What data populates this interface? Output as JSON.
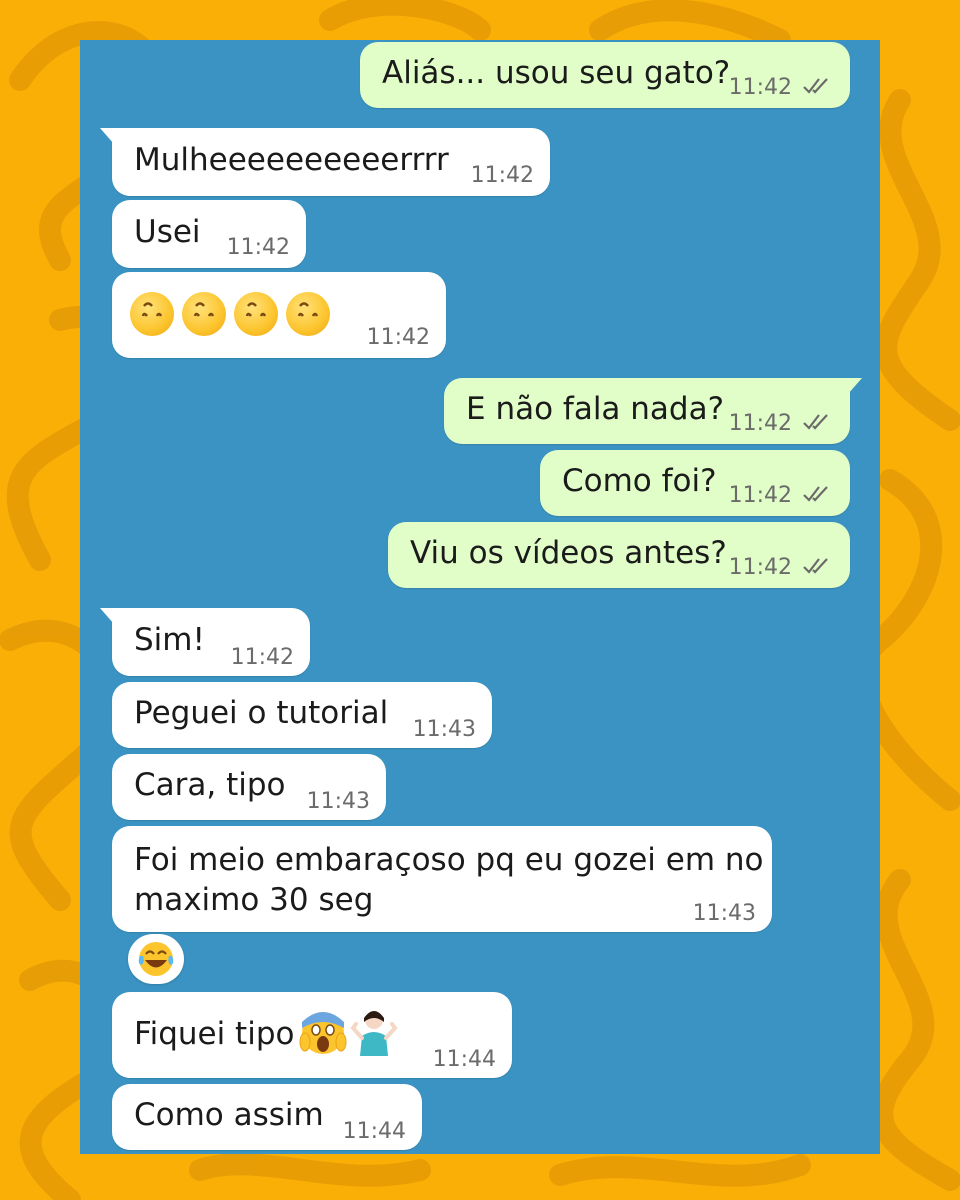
{
  "colors": {
    "background": "#F9AF06",
    "chat_background": "#3A93C2",
    "incoming_bubble": "#FFFFFF",
    "outgoing_bubble": "#E1FEC9",
    "read_ticks": "#6b6b6b"
  },
  "messages": [
    {
      "dir": "out",
      "text": "Aliás... usou seu gato?",
      "time": "11:42",
      "ticks": "double-check-icon"
    },
    {
      "dir": "in",
      "text": "Mulheeeeeeeeeerrrr",
      "time": "11:42"
    },
    {
      "dir": "in",
      "text": "Usei",
      "time": "11:42"
    },
    {
      "dir": "in",
      "text": "",
      "emoji": [
        "upside-down-face-emoji",
        "upside-down-face-emoji",
        "upside-down-face-emoji",
        "upside-down-face-emoji"
      ],
      "time": "11:42"
    },
    {
      "dir": "out",
      "text": "E não fala nada?",
      "time": "11:42",
      "ticks": "double-check-icon"
    },
    {
      "dir": "out",
      "text": "Como foi?",
      "time": "11:42",
      "ticks": "double-check-icon"
    },
    {
      "dir": "out",
      "text": "Viu os vídeos antes?",
      "time": "11:42",
      "ticks": "double-check-icon"
    },
    {
      "dir": "in",
      "text": "Sim!",
      "time": "11:42"
    },
    {
      "dir": "in",
      "text": "Peguei o tutorial",
      "time": "11:43"
    },
    {
      "dir": "in",
      "text": "Cara, tipo",
      "time": "11:43"
    },
    {
      "dir": "in",
      "text": "Foi meio embaraçoso pq eu gozei em no",
      "text2": "maximo 30 seg",
      "time": "11:43",
      "reaction": "tears-of-joy-emoji"
    },
    {
      "dir": "in",
      "text": "Fiquei tipo",
      "emoji": [
        "screaming-face-emoji",
        "person-shrugging-emoji"
      ],
      "time": "11:44"
    },
    {
      "dir": "in",
      "text": "Como assim",
      "time": "11:44"
    }
  ]
}
